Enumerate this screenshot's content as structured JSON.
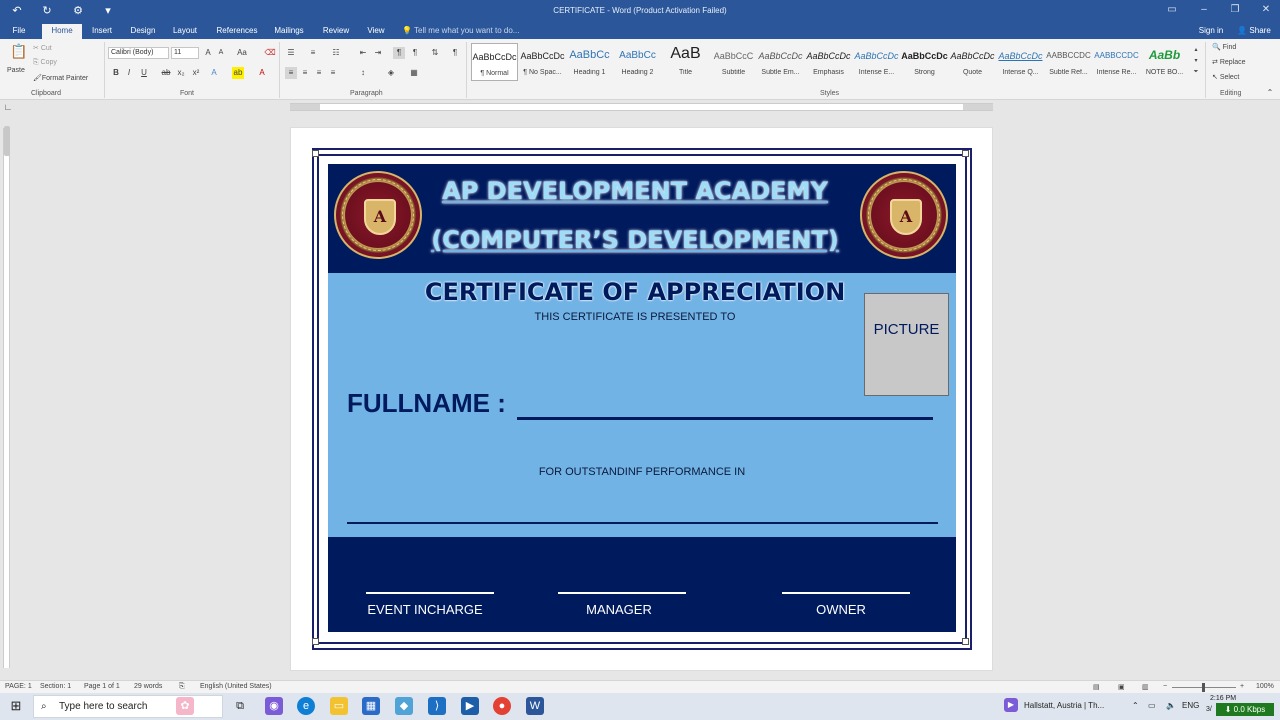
{
  "app": {
    "title": "CERTIFICATE - Word (Product Activation Failed)",
    "signin": "Sign in",
    "share": "Share",
    "tell_me": "Tell me what you want to do..."
  },
  "tabs": [
    "File",
    "Home",
    "Insert",
    "Design",
    "Layout",
    "References",
    "Mailings",
    "Review",
    "View"
  ],
  "ribbon": {
    "clipboard": {
      "paste": "Paste",
      "cut": "Cut",
      "copy": "Copy",
      "format_painter": "Format Painter",
      "label": "Clipboard"
    },
    "font": {
      "name": "Calibri (Body)",
      "size": "11",
      "label": "Font"
    },
    "paragraph": {
      "label": "Paragraph"
    },
    "styles": {
      "label": "Styles",
      "items": [
        {
          "sample": "AaBbCcDc",
          "name": "¶ Normal"
        },
        {
          "sample": "AaBbCcDc",
          "name": "¶ No Spac..."
        },
        {
          "sample": "AaBbCc",
          "name": "Heading 1"
        },
        {
          "sample": "AaBbCc",
          "name": "Heading 2"
        },
        {
          "sample": "AaB",
          "name": "Title"
        },
        {
          "sample": "AaBbCcC",
          "name": "Subtitle"
        },
        {
          "sample": "AaBbCcDc",
          "name": "Subtle Em..."
        },
        {
          "sample": "AaBbCcDc",
          "name": "Emphasis"
        },
        {
          "sample": "AaBbCcDc",
          "name": "Intense E..."
        },
        {
          "sample": "AaBbCcDc",
          "name": "Strong"
        },
        {
          "sample": "AaBbCcDc",
          "name": "Quote"
        },
        {
          "sample": "AaBbCcDc",
          "name": "Intense Q..."
        },
        {
          "sample": "AABBCCDC",
          "name": "Subtle Ref..."
        },
        {
          "sample": "AABBCCDC",
          "name": "Intense Re..."
        },
        {
          "sample": "AaBb",
          "name": "NOTE BO..."
        }
      ]
    },
    "editing": {
      "find": "Find",
      "replace": "Replace",
      "select": "Select",
      "label": "Editing"
    }
  },
  "certificate": {
    "academy_line1": "AP DEVELOPMENT ACADEMY",
    "academy_line2": "(COMPUTER’S DEVELOPMENT)",
    "title": "CERTIFICATE OF APPRECIATION",
    "presented": "THIS CERTIFICATE IS PRESENTED TO",
    "fullname_label": "FULLNAME :",
    "outstanding": "FOR OUTSTANDINF PERFORMANCE IN",
    "picture": "PICTURE",
    "seal_letter": "A",
    "signatures": [
      "EVENT INCHARGE",
      "MANAGER",
      "OWNER"
    ],
    "colors": {
      "navy": "#001a5e",
      "light_blue": "#72b3e6",
      "heading_text": "#9fdcf8",
      "picture_bg": "#c8c8c8"
    }
  },
  "status": {
    "page": "PAGE: 1",
    "section": "Section: 1",
    "page_of": "Page 1 of 1",
    "words": "29 words",
    "language": "English (United States)",
    "zoom": "100%"
  },
  "taskbar": {
    "search_placeholder": "Type here to search",
    "weather": "Hallstatt, Austria | Th...",
    "lang": "ENG",
    "time": "2:16 PM",
    "date": "3/",
    "speed": "0.0 Kbps"
  }
}
